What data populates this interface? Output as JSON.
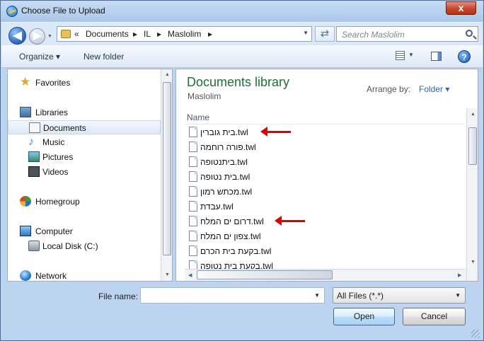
{
  "window": {
    "title": "Choose File to Upload",
    "close_label": "x"
  },
  "navigation": {
    "back_glyph": "◀",
    "forward_glyph": "▶",
    "address_parts": [
      "«",
      "Documents",
      "▸",
      "IL",
      "▸",
      "Maslolim",
      "▸"
    ],
    "search_placeholder": "Search Maslolim"
  },
  "toolbar": {
    "organize_label": "Organize ▾",
    "new_folder_label": "New folder",
    "help_label": "?"
  },
  "sidebar": {
    "items": [
      {
        "label": "Favorites",
        "icon": "star-icon"
      },
      {
        "label": "Libraries",
        "icon": "libraries-icon"
      },
      {
        "label": "Documents",
        "icon": "documents-icon",
        "selected": true
      },
      {
        "label": "Music",
        "icon": "music-icon"
      },
      {
        "label": "Pictures",
        "icon": "pictures-icon"
      },
      {
        "label": "Videos",
        "icon": "videos-icon"
      },
      {
        "label": "Homegroup",
        "icon": "homegroup-icon"
      },
      {
        "label": "Computer",
        "icon": "computer-icon"
      },
      {
        "label": "Local Disk (C:)",
        "icon": "disk-icon"
      },
      {
        "label": "Network",
        "icon": "network-icon"
      }
    ]
  },
  "main": {
    "library_title": "Documents library",
    "library_subtitle": "Maslolim",
    "arrange_label": "Arrange by:",
    "arrange_value": "Folder ▾",
    "column_name": "Name",
    "files": [
      "בית גוברין.twl",
      "פורה רוחמה.twl",
      "ביתנטופה.twl",
      "בית נטופה.twl",
      "מכתש רמון.twl",
      "עבדת.twl",
      "דרום ים המלח.twl",
      "צפון ים המלח.twl",
      "בקעת בית הכרם.twl",
      "בקעת בית נטופה.twl"
    ],
    "annotation_colors": {
      "arrow": "#e00000"
    }
  },
  "footer": {
    "file_name_label": "File name:",
    "file_name_value": "",
    "file_type_value": "All Files (*.*)",
    "open_label": "Open",
    "cancel_label": "Cancel"
  }
}
